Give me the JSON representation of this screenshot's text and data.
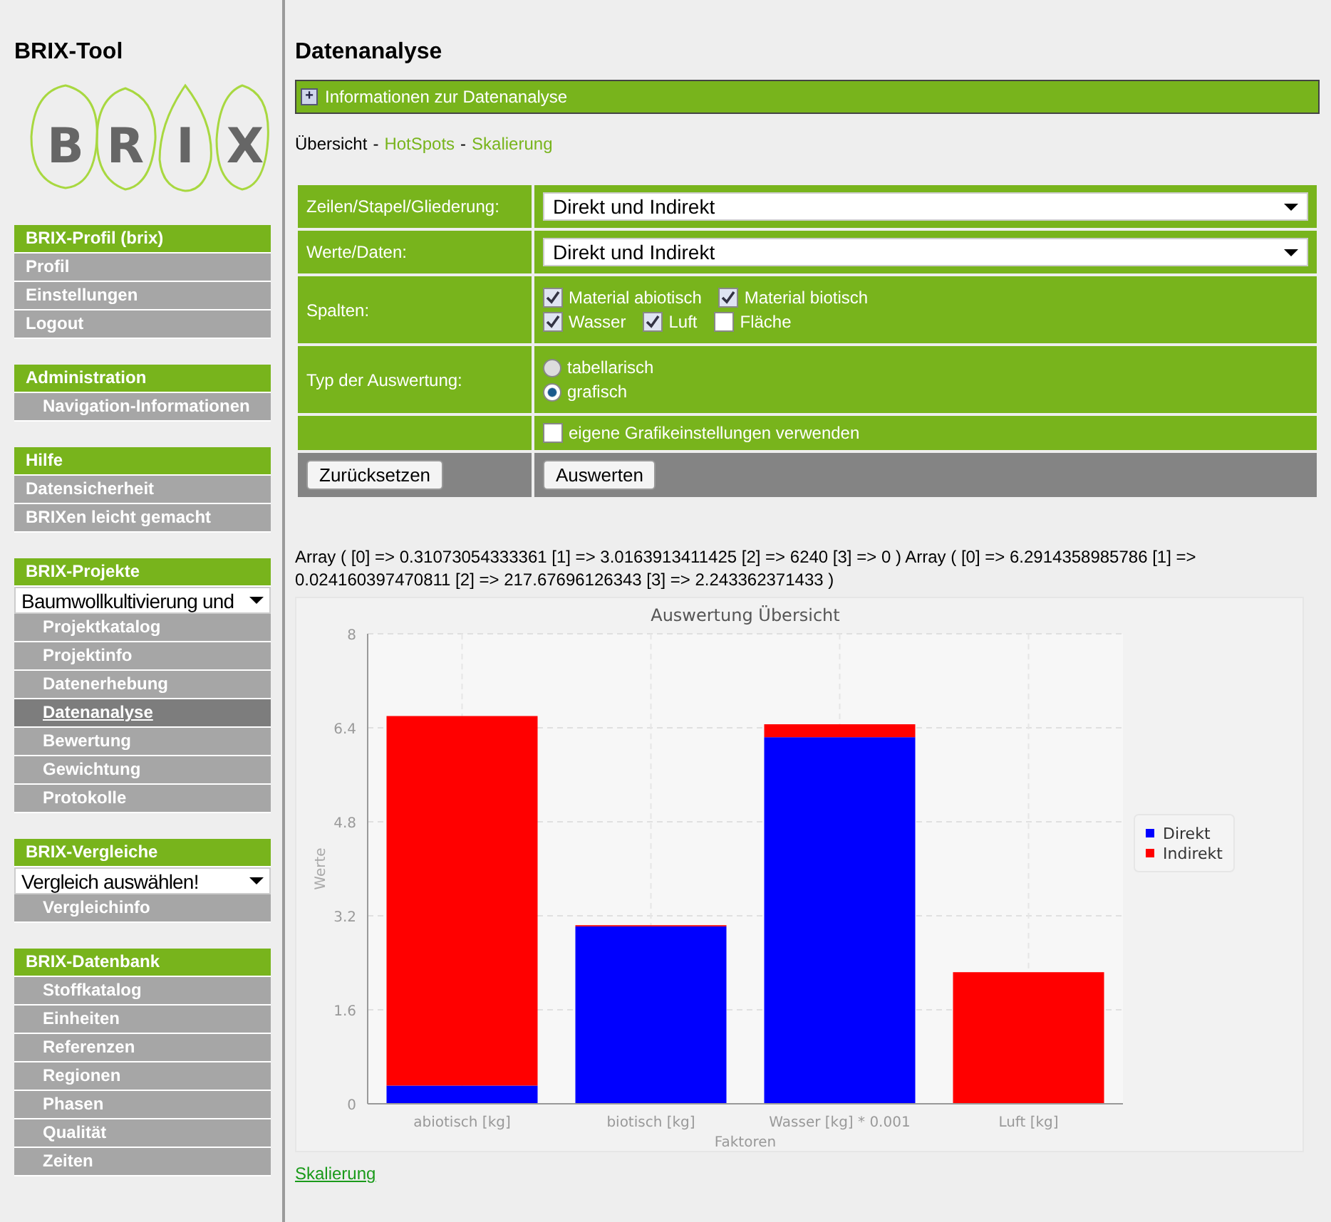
{
  "sidebar": {
    "title": "BRIX-Tool",
    "logo_letters": [
      "B",
      "R",
      "I",
      "X"
    ],
    "sections": [
      {
        "heading": "BRIX-Profil (brix)",
        "items": [
          {
            "kind": "item",
            "label": "Profil",
            "selected": false
          },
          {
            "kind": "item",
            "label": "Einstellungen",
            "selected": false
          },
          {
            "kind": "item",
            "label": "Logout",
            "selected": false
          }
        ]
      },
      {
        "heading": "Administration",
        "items": [
          {
            "kind": "subitem",
            "label": "Navigation-Informationen",
            "selected": false
          }
        ]
      },
      {
        "heading": "Hilfe",
        "items": [
          {
            "kind": "item",
            "label": "Datensicherheit",
            "selected": false
          },
          {
            "kind": "item",
            "label": "BRIXen leicht gemacht",
            "selected": false
          }
        ]
      },
      {
        "heading": "BRIX-Projekte",
        "items": [
          {
            "kind": "select",
            "label": "Baumwollkultivierung und"
          },
          {
            "kind": "subitem",
            "label": "Projektkatalog",
            "selected": false
          },
          {
            "kind": "subitem",
            "label": "Projektinfo",
            "selected": false
          },
          {
            "kind": "subitem",
            "label": "Datenerhebung",
            "selected": false
          },
          {
            "kind": "subitem",
            "label": "Datenanalyse",
            "selected": true
          },
          {
            "kind": "subitem",
            "label": "Bewertung",
            "selected": false
          },
          {
            "kind": "subitem",
            "label": "Gewichtung",
            "selected": false
          },
          {
            "kind": "subitem",
            "label": "Protokolle",
            "selected": false
          }
        ]
      },
      {
        "heading": "BRIX-Vergleiche",
        "items": [
          {
            "kind": "select",
            "label": "Vergleich auswählen!"
          },
          {
            "kind": "subitem",
            "label": "Vergleichinfo",
            "selected": false
          }
        ]
      },
      {
        "heading": "BRIX-Datenbank",
        "items": [
          {
            "kind": "subitem",
            "label": "Stoffkatalog",
            "selected": false
          },
          {
            "kind": "subitem",
            "label": "Einheiten",
            "selected": false
          },
          {
            "kind": "subitem",
            "label": "Referenzen",
            "selected": false
          },
          {
            "kind": "subitem",
            "label": "Regionen",
            "selected": false
          },
          {
            "kind": "subitem",
            "label": "Phasen",
            "selected": false
          },
          {
            "kind": "subitem",
            "label": "Qualität",
            "selected": false
          },
          {
            "kind": "subitem",
            "label": "Zeiten",
            "selected": false
          }
        ]
      }
    ]
  },
  "main": {
    "title": "Datenanalyse",
    "info_bar": {
      "icon": "+",
      "label": "Informationen zur Datenanalyse",
      "expanded": false
    },
    "breadcrumb": [
      {
        "kind": "link",
        "label": "Übersicht",
        "selected": true
      },
      {
        "kind": "separator",
        "label": "-"
      },
      {
        "kind": "link",
        "label": "HotSpots",
        "selected": false
      },
      {
        "kind": "separator",
        "label": "-"
      },
      {
        "kind": "link",
        "label": "Skalierung",
        "selected": false
      }
    ],
    "form": {
      "rows": [
        {
          "kind": "select",
          "label": "Zeilen/Stapel/Gliederung:",
          "value": "Direkt und Indirekt"
        },
        {
          "kind": "select",
          "label": "Werte/Daten:",
          "value": "Direkt und Indirekt"
        },
        {
          "kind": "checkboxes",
          "label": "Spalten:",
          "lines": [
            [
              {
                "label": "Material abiotisch",
                "checked": true
              },
              {
                "label": "Material biotisch",
                "checked": true
              }
            ],
            [
              {
                "label": "Wasser",
                "checked": true
              },
              {
                "label": "Luft",
                "checked": true
              },
              {
                "label": "Fläche",
                "checked": false
              }
            ]
          ]
        },
        {
          "kind": "radios",
          "label": "Typ der Auswertung:",
          "options": [
            {
              "label": "tabellarisch",
              "selected": false
            },
            {
              "label": "grafisch",
              "selected": true
            }
          ]
        },
        {
          "kind": "checkbox",
          "option": {
            "label": "eigene Grafikeinstellungen verwenden",
            "checked": false
          }
        }
      ],
      "buttons": [
        "Zurücksetzen",
        "Auswerten"
      ]
    },
    "debug_output": "Array ( [0] => 0.31073054333361 [1] => 3.0163913411425 [2] => 6240 [3] => 0 ) Array ( [0] => 6.2914358985786 [1] => 0.024160397470811 [2] => 217.67696126343 [3] => 2.243362371433 )",
    "chart_data": {
      "type": "bar",
      "title": "Auswertung Übersicht",
      "xlabel": "Faktoren",
      "ylabel": "Werte",
      "stacked": true,
      "categories": [
        "abiotisch [kg]",
        "biotisch [kg]",
        "Wasser [kg] * 0.001",
        "Luft [kg]"
      ],
      "series": [
        {
          "name": "Direkt",
          "color": "#0000ff",
          "values": [
            0.31,
            3.02,
            6.24,
            0
          ]
        },
        {
          "name": "Indirekt",
          "color": "#ff0000",
          "values": [
            6.29,
            0.02,
            0.22,
            2.24
          ]
        }
      ],
      "ylim": [
        0,
        8
      ],
      "grid": true,
      "legend": true,
      "yticks": [
        0,
        1.6,
        3.2,
        4.8,
        6.4,
        8
      ]
    },
    "footer_link": "Skalierung"
  }
}
